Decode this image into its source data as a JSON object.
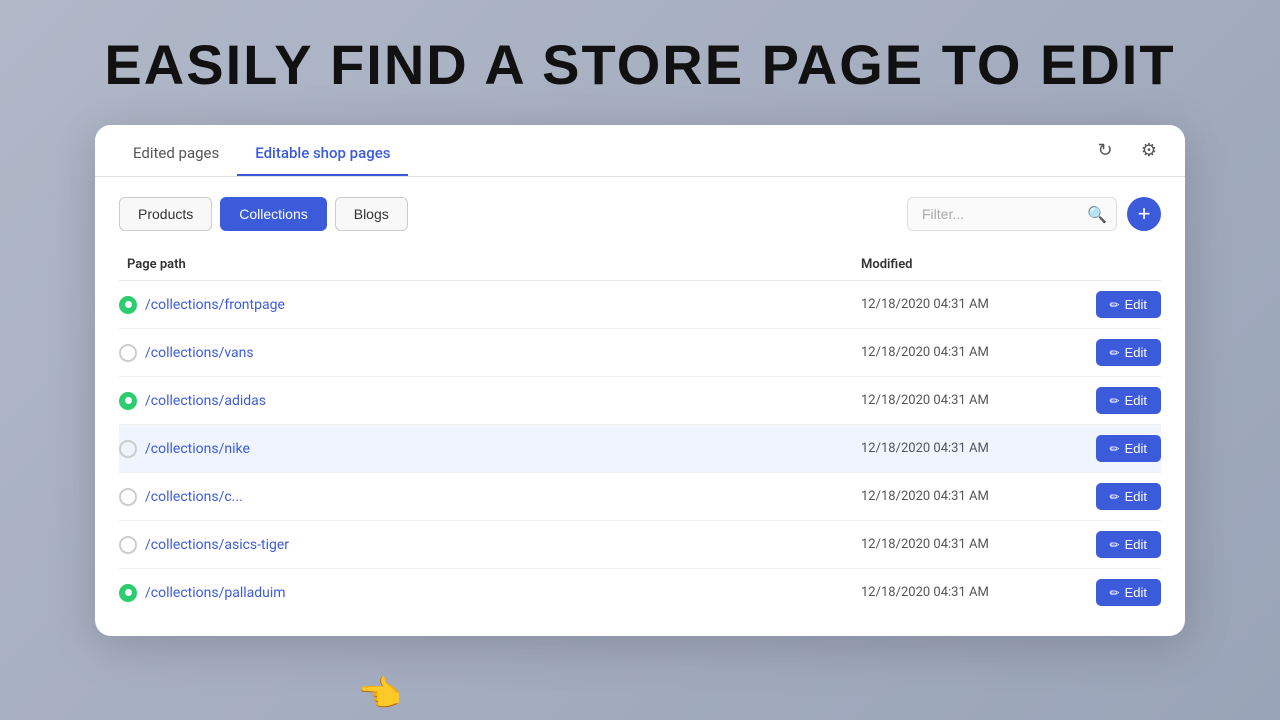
{
  "hero": {
    "title": "EASILY FIND A STORE PAGE TO EDIT"
  },
  "tabs": {
    "items": [
      {
        "label": "Edited pages",
        "active": false
      },
      {
        "label": "Editable shop pages",
        "active": true
      }
    ],
    "refresh_icon": "↻",
    "settings_icon": "⚙"
  },
  "filters": {
    "buttons": [
      {
        "label": "Products",
        "active": false
      },
      {
        "label": "Collections",
        "active": true
      },
      {
        "label": "Blogs",
        "active": false
      }
    ],
    "filter_placeholder": "Filter...",
    "add_icon": "+"
  },
  "table": {
    "headers": [
      {
        "label": "Page path"
      },
      {
        "label": "Modified"
      },
      {
        "label": ""
      }
    ],
    "rows": [
      {
        "path": "/collections/frontpage",
        "modified": "12/18/2020 04:31 AM",
        "active": true,
        "edit_label": "Edit",
        "highlighted": false
      },
      {
        "path": "/collections/vans",
        "modified": "12/18/2020 04:31 AM",
        "active": false,
        "edit_label": "Edit",
        "highlighted": false
      },
      {
        "path": "/collections/adidas",
        "modified": "12/18/2020 04:31 AM",
        "active": true,
        "edit_label": "Edit",
        "highlighted": false
      },
      {
        "path": "/collections/nike",
        "modified": "12/18/2020 04:31 AM",
        "active": false,
        "edit_label": "Edit",
        "highlighted": true
      },
      {
        "path": "/collections/c...",
        "modified": "12/18/2020 04:31 AM",
        "active": false,
        "edit_label": "Edit",
        "highlighted": false
      },
      {
        "path": "/collections/asics-tiger",
        "modified": "12/18/2020 04:31 AM",
        "active": false,
        "edit_label": "Edit",
        "highlighted": false
      },
      {
        "path": "/collections/palladuim",
        "modified": "12/18/2020 04:31 AM",
        "active": true,
        "edit_label": "Edit",
        "highlighted": false
      }
    ]
  }
}
